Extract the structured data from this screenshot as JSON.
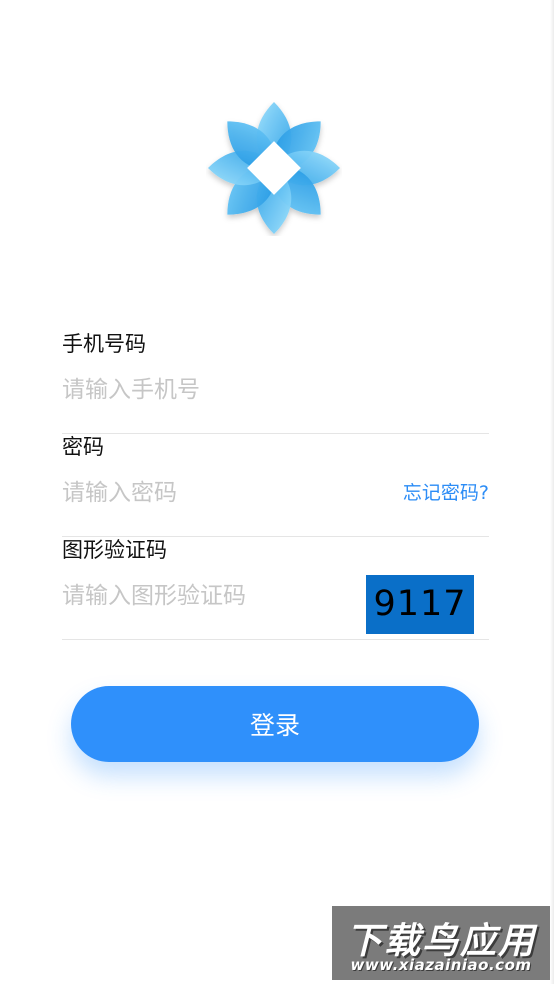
{
  "login": {
    "phone": {
      "label": "手机号码",
      "placeholder": "请输入手机号",
      "value": ""
    },
    "password": {
      "label": "密码",
      "placeholder": "请输入密码",
      "value": "",
      "forgot_link": "忘记密码?"
    },
    "captcha": {
      "label": "图形验证码",
      "placeholder": "请输入图形验证码",
      "value": "",
      "code": "9117"
    },
    "submit_label": "登录"
  },
  "watermark": {
    "title": "下载鸟应用",
    "url": "www.xiazainiao.com"
  },
  "colors": {
    "accent": "#2f90fb",
    "link": "#2b8cf6",
    "captcha_bg": "#0a6fc8",
    "logo_light": "#8fd8fb",
    "logo_dark": "#2aa2ea"
  },
  "icons": {
    "logo": "flower-diamond-logo-icon"
  }
}
